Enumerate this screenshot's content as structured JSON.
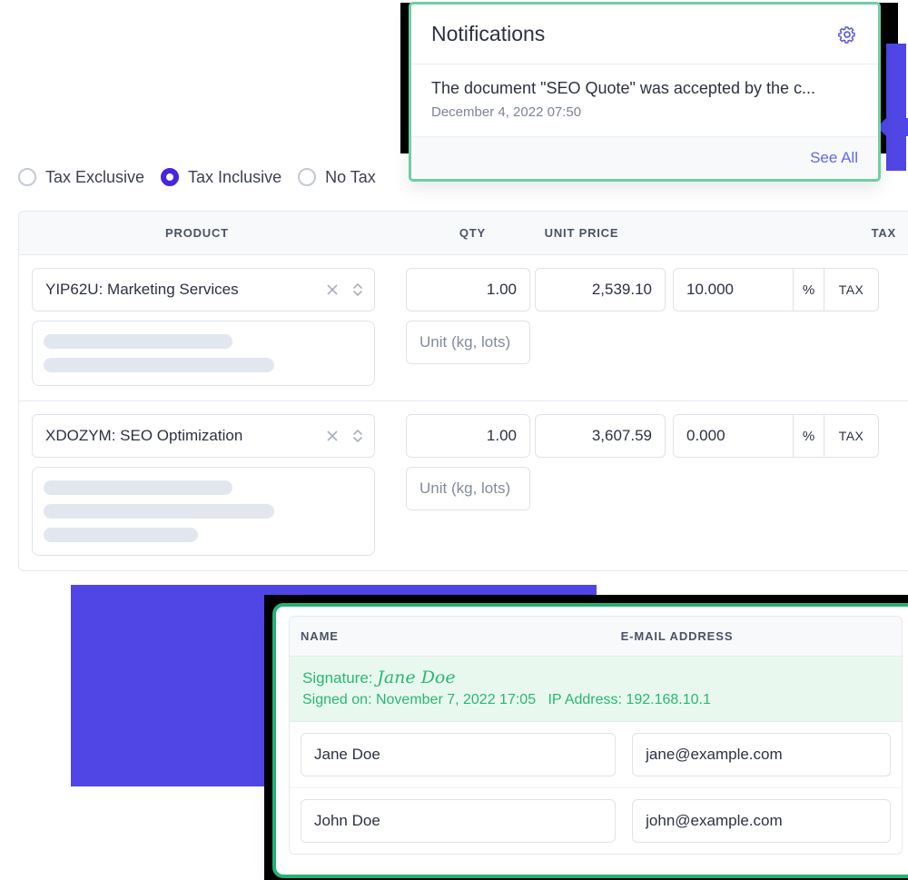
{
  "colors": {
    "accent_purple": "#4f46e5",
    "radio_selected": "#4527e0",
    "notif_border_green": "#6dcfa4",
    "sig_border_green": "#24b273",
    "sig_text_green": "#2bb673",
    "link_purple": "#6366f1",
    "skeleton_gray": "#e2e7ef"
  },
  "tax_mode": {
    "options": [
      {
        "label": "Tax Exclusive",
        "selected": false
      },
      {
        "label": "Tax Inclusive",
        "selected": true
      },
      {
        "label": "No Tax",
        "selected": false
      }
    ]
  },
  "products_table": {
    "headers": {
      "product": "PRODUCT",
      "qty": "QTY",
      "unit_price": "UNIT PRICE",
      "tax": "TAX"
    },
    "unit_placeholder": "Unit (kg, lots)",
    "percent_symbol": "%",
    "tax_button_label": "TAX",
    "rows": [
      {
        "product": "YIP62U: Marketing Services",
        "qty": "1.00",
        "unit_price": "2,539.10",
        "tax_rate": "10.000",
        "description_lines": 2
      },
      {
        "product": "XDOZYM: SEO Optimization",
        "qty": "1.00",
        "unit_price": "3,607.59",
        "tax_rate": "0.000",
        "description_lines": 3
      }
    ]
  },
  "notifications": {
    "title": "Notifications",
    "settings_icon": "gear-icon",
    "items": [
      {
        "text": "The document \"SEO Quote\" was accepted by the c...",
        "date": "December 4, 2022 07:50"
      }
    ],
    "see_all_label": "See All"
  },
  "signature_panel": {
    "headers": {
      "name": "NAME",
      "email": "E-MAIL ADDRESS"
    },
    "banner": {
      "signature_label": "Signature:",
      "signature_name": "Jane Doe",
      "signed_on_label": "Signed on:",
      "signed_on_value": "November 7, 2022 17:05",
      "ip_label": "IP Address:",
      "ip_value": "192.168.10.1"
    },
    "rows": [
      {
        "name": "Jane Doe",
        "email": "jane@example.com"
      },
      {
        "name": "John Doe",
        "email": "john@example.com"
      }
    ]
  }
}
